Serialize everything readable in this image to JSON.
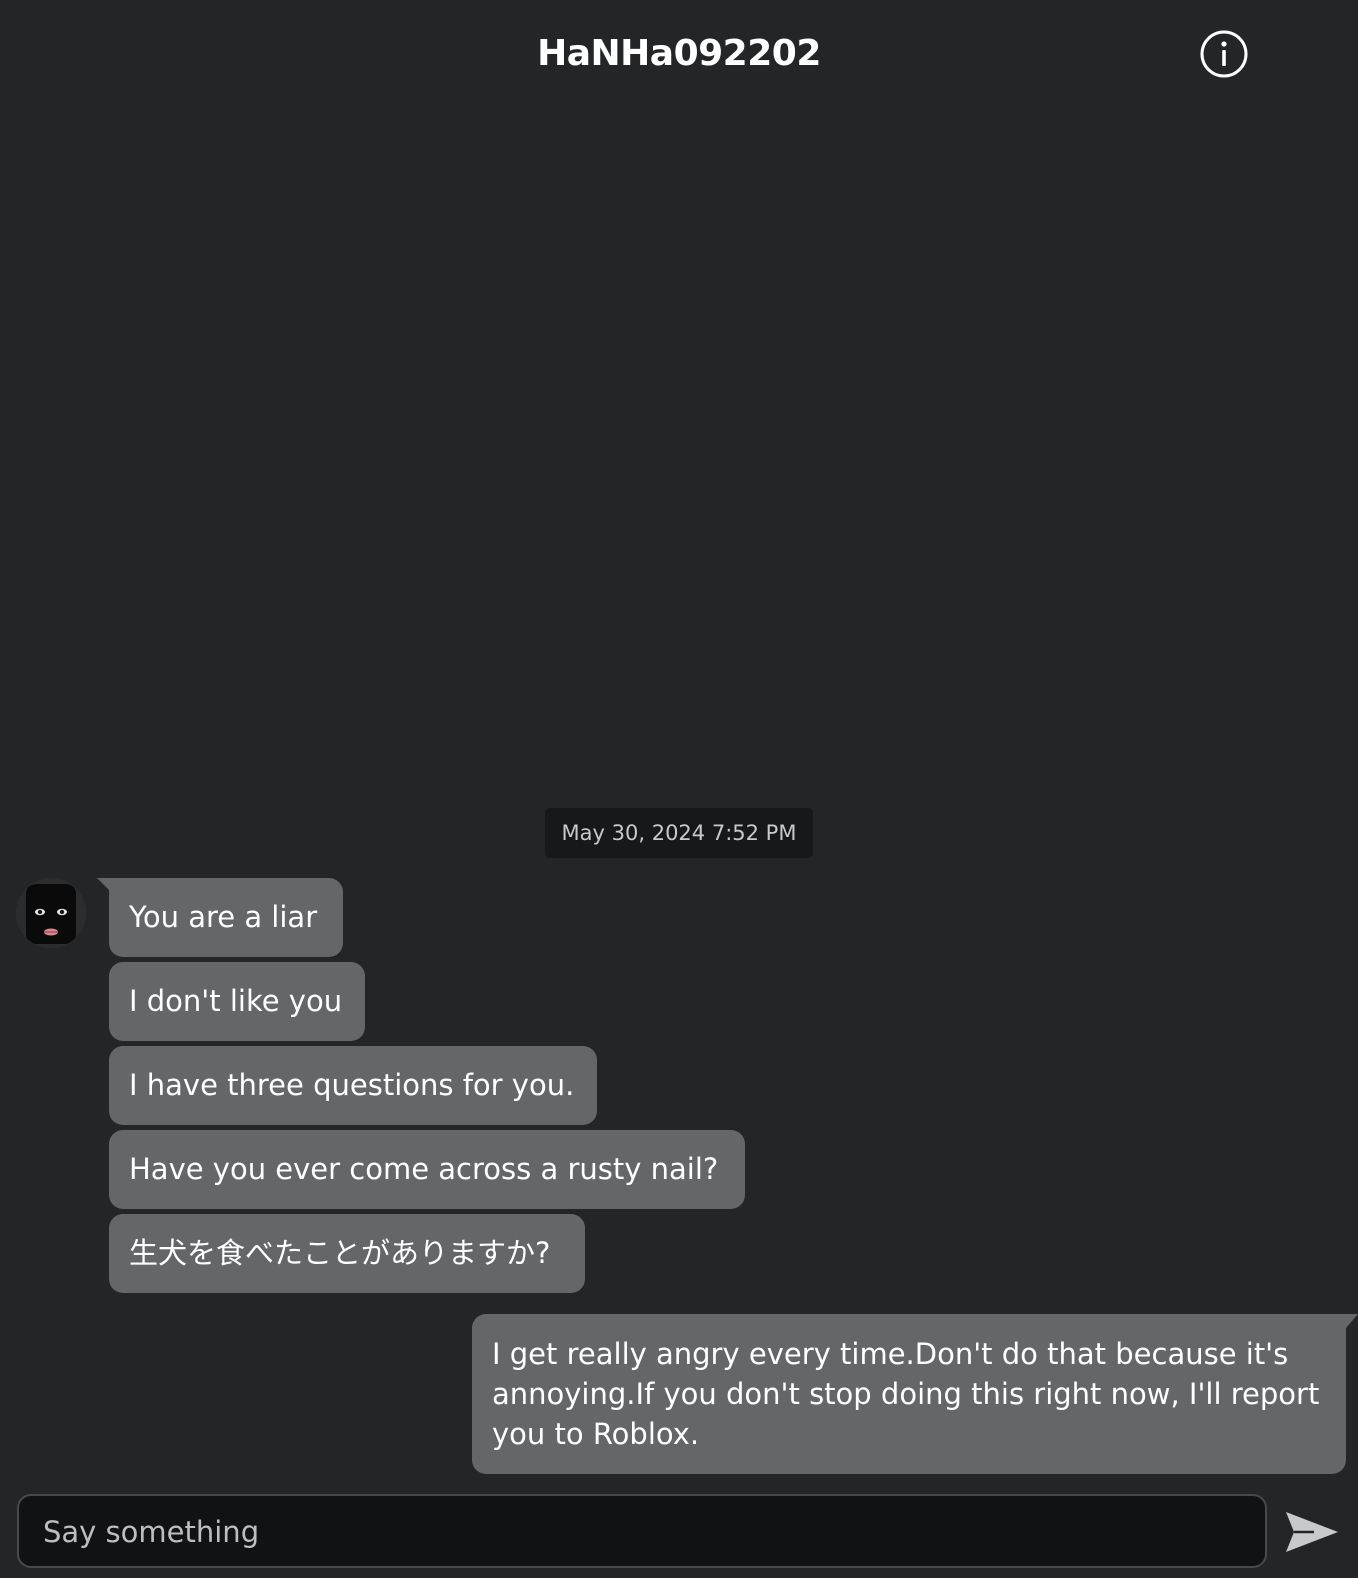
{
  "header": {
    "title": "HaNHa092202",
    "info_icon": "info-circle-icon"
  },
  "conversation": {
    "timestamp": "May 30, 2024 7:52 PM",
    "incoming_messages": [
      "You are a liar",
      "I don't like you",
      "I have three questions for you.",
      "Have you ever come across a rusty nail?",
      "生犬を食べたことがありますか?"
    ],
    "outgoing_messages": [
      "I get really angry every time.Don't do that because it's annoying.If you don't stop doing this right now, I'll report you to Roblox."
    ]
  },
  "composer": {
    "placeholder": "Say something",
    "value": "",
    "send_icon": "send-arrow-icon"
  },
  "colors": {
    "background": "#232527",
    "bubble": "#656668",
    "timestamp_bg": "#17181a",
    "input_bg": "#111214",
    "input_border": "#47494c",
    "text": "#ffffff",
    "send_icon": "#c8c9ca"
  }
}
